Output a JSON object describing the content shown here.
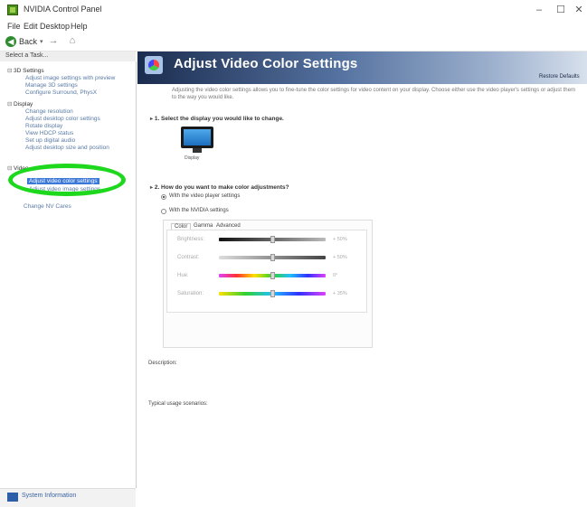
{
  "window": {
    "title": "NVIDIA Control Panel",
    "controls": [
      "–",
      "☐",
      "✕"
    ]
  },
  "menu": [
    "File",
    "Edit",
    "Desktop",
    "Help"
  ],
  "toolbar": {
    "back_label": "Back",
    "back_dropdown": "▾",
    "forward_icon": "→",
    "home_icon": "⌂"
  },
  "sidebar": {
    "header": "Select a Task...",
    "items": [
      {
        "label": "3D Settings",
        "expander": "⊟",
        "category": true
      },
      {
        "label": "Adjust image settings with preview",
        "category": false
      },
      {
        "label": "Manage 3D settings",
        "category": false
      },
      {
        "label": "Configure Surround, PhysX",
        "category": false
      },
      {
        "label": "Display",
        "expander": "⊟",
        "category": true
      },
      {
        "label": "Change resolution",
        "category": false
      },
      {
        "label": "Adjust desktop color settings",
        "category": false
      },
      {
        "label": "Rotate display",
        "category": false
      },
      {
        "label": "View HDCP status",
        "category": false
      },
      {
        "label": "Set up digital audio",
        "category": false
      },
      {
        "label": "Adjust desktop size and position",
        "category": false
      },
      {
        "label": "Video",
        "expander": "⊟",
        "category": true
      },
      {
        "label": "Adjust video color settings",
        "category": false,
        "selected": true
      },
      {
        "label": "Adjust video image settings",
        "category": false
      },
      {
        "label": "Change NV Cares",
        "category": false
      }
    ],
    "system_information": "System Information"
  },
  "page": {
    "title": "Adjust Video Color Settings",
    "restore_defaults": "Restore Defaults",
    "description": "Adjusting the video color settings allows you to fine-tune the color settings for video content on your display. Choose either use the video player's settings or adjust them to the way you would like.",
    "section1": {
      "heading": "1. Select the display you would like to change.",
      "arrow": "▸",
      "display_name": "Display"
    },
    "section2": {
      "heading": "2. How do you want to make color adjustments?",
      "arrow": "▸",
      "options": [
        {
          "label": "With the video player settings",
          "selected": true
        },
        {
          "label": "With the NVIDIA settings",
          "selected": false
        }
      ],
      "tabs": [
        "Color",
        "Gamma",
        "Advanced"
      ],
      "sliders": [
        {
          "label": "Brightness:",
          "value": "+ 50%",
          "level": 0.5
        },
        {
          "label": "Contrast:",
          "value": "+ 50%",
          "level": 0.5
        },
        {
          "label": "Hue:",
          "value": "0°",
          "level": 0.5
        },
        {
          "label": "Saturation:",
          "value": "+ 35%",
          "level": 0.5
        }
      ]
    },
    "description_label": "Description:",
    "usage_label": "Typical usage scenarios:"
  },
  "colors": {
    "accent_selected": "#3b78d8",
    "highlight_ring": "#1ed81e",
    "banner_dark": "#1b2d4f"
  }
}
